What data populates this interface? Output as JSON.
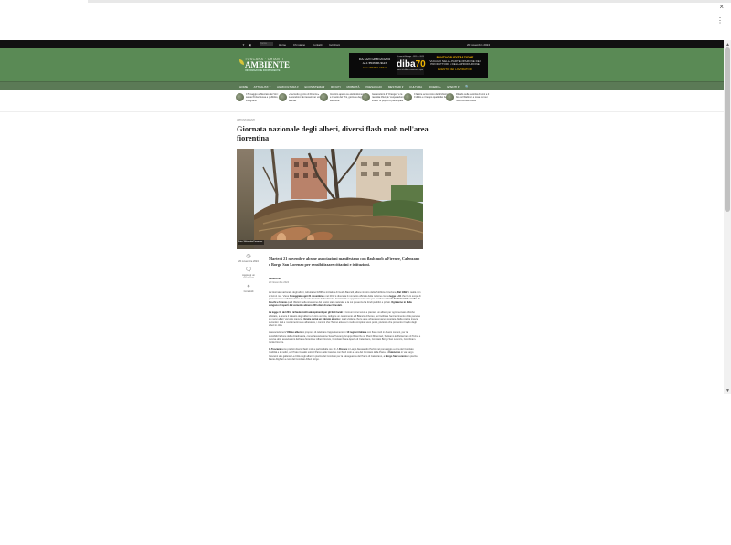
{
  "browser": {
    "close_glyph": "×",
    "menu_glyph": "⋮"
  },
  "topbar": {
    "social_icons": [
      "facebook-icon",
      "twitter-icon",
      "rss-icon"
    ],
    "social_glyphs": "f ♥ ▣",
    "search_placeholder": "Cerca",
    "links": [
      "Home",
      "Chi siamo",
      "Contatti",
      "Iscrizioni"
    ],
    "date": "20 novembre 2024"
  },
  "logo": {
    "tagline": "TOSCANA · CHIANTI",
    "name": "AMBIENTE",
    "subtitle": "INFORMAZIONE INDIPENDENTE"
  },
  "banner": {
    "left_text": "DA SAN GIMIGNANO ALL'HONDURAS",
    "left_sub": "UN CAMMINO UNICO",
    "brand_top": "70 anni di Bottega · 1955 — 2025",
    "brand": "diba",
    "brand_num": "70",
    "brand_bottom": "amici di diba e commercio equo",
    "right_title": "PANTAGRUDITRAZIONE",
    "right_text": "VIAGGIO NELLA PARTECIPAZIONE DEI PRODUTTORI E DELLA PRODUZIONE",
    "right_bottom": "EVENTO DEI LAVORATORI"
  },
  "nav": {
    "items": [
      "HOME",
      "ATTUALITA' ▾",
      "AGRICOLTURA ▾",
      "ECOSISTEMA ▾",
      "RIFIUTI",
      "MOBILITÀ",
      "PAESAGGIO",
      "MESTIERI ▾",
      "CULTURA",
      "RICERCA",
      "EVENTI ▾"
    ],
    "search_glyph": "🔍"
  },
  "trending": [
    "Il 5 maggio al Mercato dei Vini: salute Porta Nuova e pubblico, insegnanti",
    "«Secondo giorno di Firenze» Lavorazioni dei tessuti per unità e animali",
    "Incontro aperto su elettrodomestici e il ruolo del Vini, giornate degli elettricità",
    "Generazioni di 'Oranges' e la raccolta rifiuti, le 'cooperazioni, eventi' di popolo e partecipale",
    "Il fattore economico della Mostra - Il diritto e il tempo quello dei beni",
    "Ritardo sulle autorità di anni e il bio del Webinar e cose dei sui Nord Ambientalista"
  ],
  "article": {
    "breadcrumb": "APPUNTAMENTI",
    "title": "Giornata nazionale degli alberi, diversi flash mob nell'area fiorentina",
    "image_caption": "Foto: Wikimedia/Commons",
    "side_date": "20 novembre 2024",
    "side_comments": "Aggiungi un commento",
    "side_share": "Condividi",
    "lead": "Martedì 21 novembre alcune associazioni manifestano con flash mob a Firenze, Calenzano e Borgo San Lorenzo per sensibilizzare cittadini e istituzioni.",
    "author": "Redazione",
    "date": "20 Novembre 2024",
    "p1_a": "La Giornata nazionale degli alberi, istituita nel 1898 su iniziativa di Guido Baccelli, allora ministro della Pubblica Istruzione, ",
    "p1_b": "Dal 1992",
    "p1_c": " in realtà non si fermò mai. Viene ",
    "p1_d": "festeggiata ogni 21 novembre",
    "p1_e": " e nel 2013 è divenuta il momento ufficiale della nazione con la ",
    "p1_f": "legge n.10",
    "p1_g": " che ha lo scopo di promuovere in collaborazione tra scuole la tutela dell'ambiente. Si tratta di un appuntamento nato per ricordare il ",
    "p1_h": "ruolo fondamentale svolto da boschi e foreste",
    "p1_i": " quali riflettori nella situazione del nostro stato naturale, e la cui presenza ha fondi pubblici e privati. ",
    "p1_j": "Ogni anno in Italia vengono ricoperti dal cemento almeno 300 ettari di aree forestali.",
    "p2_a": "La legge 10 del 2013 ",
    "p2_b": "richiede molti adempimenti per gli Enti locali",
    "p2_c": ": i Comuni sono tenuti a piantare un albero per ogni neonato o bimbo adottato, a tenere il catasto degli alberi e la loro verifica, redigere un censimento e il Bilancio Arboreo, per facilitare l'accrescimento delle persone su nuovi alberi 'verso le pianure'. ",
    "p2_d": "Grazie peròà un silenzio attorno",
    "p2_e": " i quali vigilano che le aree urbane vengano rispettate. Nella pratica invece, secondo i dati e i censimenti sulle alberature, i comuni che l'hanno attuata in modo completo sono pochi, piuttosto che prevenire il taglio degli alberi in città.",
    "p3_a": "L'associazione ",
    "p3_b": "L'Ultimo albero",
    "p3_c": " si propone di celebrare l'appuntamento in ",
    "p3_d": "10 regioni italiane",
    "p3_e": " con flash mob in diversi comuni, per la sensibilizzazione della cittadinanza, come l'associazione Save Tuscany, Gruppo Ricerche su Pianti Millennari, Salviamo le Panterrane di Torino e diverse altre associazioni dell'area fiorentina: Alberi Firenze, Comitato Piana Aperta di Calenzano, Comitato Borgo San Lorenzo, Coordinam. Verde Firenze.",
    "p4_a": "In Toscana",
    "p4_b": " sono previsti diversi flash mob a partire dalle ore 10. A ",
    "p4_c": "Firenze",
    "p4_d": " in Largo Alessandro Pertini nel pomeriggio a cura del Comitato Viabilità e le radici, a Il Prato Cavallo sotto il Parco delle Cascine con flash mob a cura del Comitato della Piana. A ",
    "p4_e": "Calenzano",
    "p4_f": " in via Largo Giovanni alle gallerie, La Città degli alberi in piazza del Comitato per la salvaguardia del Parco di Calenzano, a ",
    "p4_g": "Borgo San Lorenzo",
    "p4_h": " in piazza Dante Alighieri a cura del Comitato Alberi Borgo."
  }
}
